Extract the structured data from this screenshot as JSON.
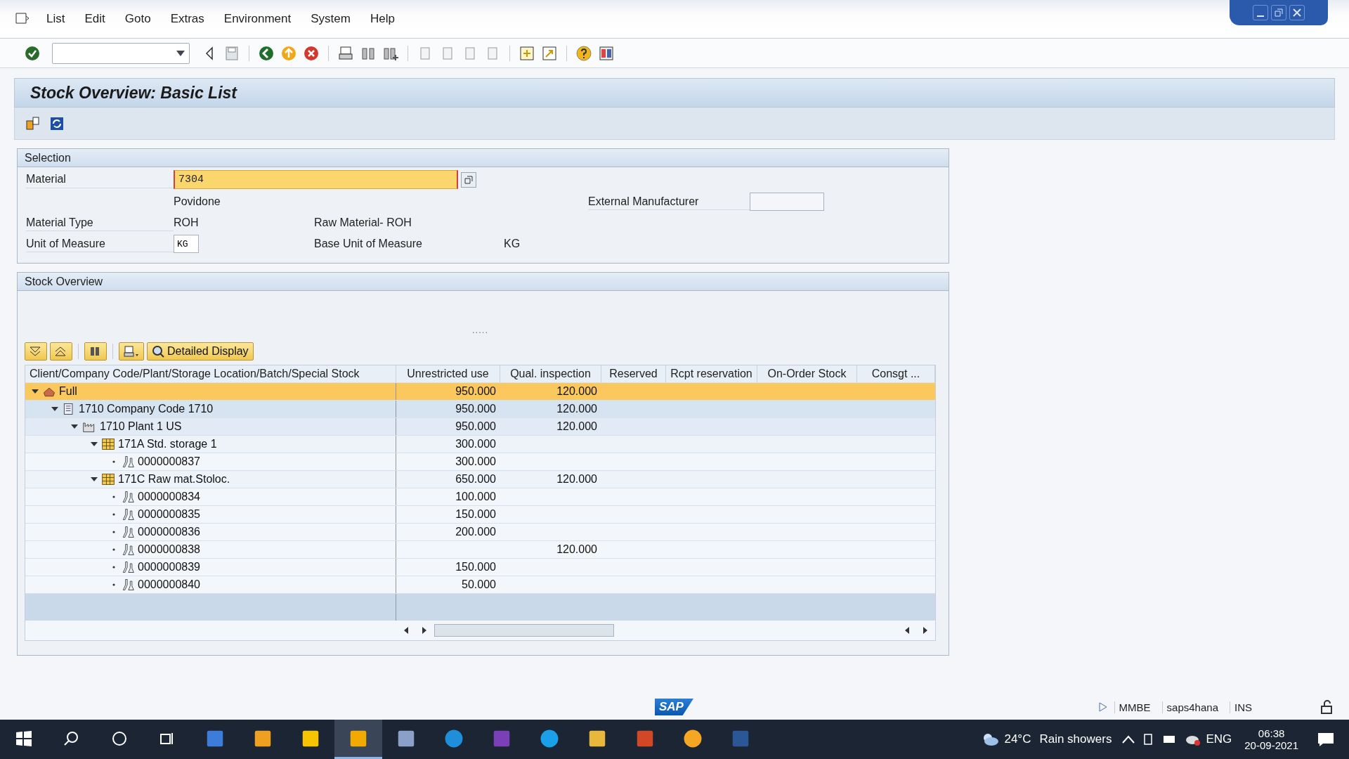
{
  "menu": [
    "List",
    "Edit",
    "Goto",
    "Extras",
    "Environment",
    "System",
    "Help"
  ],
  "title": "Stock Overview: Basic List",
  "selection": {
    "title": "Selection",
    "material": {
      "label": "Material",
      "value": "7304",
      "description": "Povidone"
    },
    "external_manufacturer": {
      "label": "External Manufacturer"
    },
    "material_type": {
      "label": "Material Type",
      "value": "ROH",
      "description": "Raw Material- ROH"
    },
    "unit": {
      "label": "Unit of Measure",
      "value": "KG",
      "base_label": "Base Unit of Measure",
      "base_value": "KG"
    }
  },
  "stock": {
    "title": "Stock Overview",
    "splitter": ".....",
    "detail_button": "Detailed Display",
    "columns": [
      "Client/Company Code/Plant/Storage Location/Batch/Special Stock",
      "Unrestricted use",
      "Qual. inspection",
      "Reserved",
      "Rcpt reservation",
      "On-Order Stock",
      "Consgt ..."
    ],
    "tree": [
      {
        "kind": "root",
        "label": "Full",
        "unrestricted": "950.000",
        "qual": "120.000",
        "selected": true,
        "expanded": true,
        "children": [
          {
            "kind": "company",
            "label": "1710 Company Code 1710",
            "unrestricted": "950.000",
            "qual": "120.000",
            "selected": false,
            "expanded": true,
            "children": [
              {
                "kind": "plant",
                "label": "1710 Plant 1 US",
                "unrestricted": "950.000",
                "qual": "120.000",
                "selected": false,
                "expanded": true,
                "children": [
                  {
                    "kind": "storage",
                    "label": "171A Std. storage 1",
                    "unrestricted": "300.000",
                    "selected": false,
                    "expanded": true,
                    "children": [
                      {
                        "kind": "batch",
                        "label": "0000000837",
                        "unrestricted": "300.000",
                        "selected": false
                      }
                    ]
                  },
                  {
                    "kind": "storage",
                    "label": "171C Raw mat.Stoloc.",
                    "unrestricted": "650.000",
                    "qual": "120.000",
                    "selected": false,
                    "expanded": true,
                    "children": [
                      {
                        "kind": "batch",
                        "label": "0000000834",
                        "unrestricted": "100.000",
                        "selected": false
                      },
                      {
                        "kind": "batch",
                        "label": "0000000835",
                        "unrestricted": "150.000",
                        "selected": false
                      },
                      {
                        "kind": "batch",
                        "label": "0000000836",
                        "unrestricted": "200.000",
                        "selected": false
                      },
                      {
                        "kind": "batch",
                        "label": "0000000838",
                        "qual": "120.000",
                        "selected": false
                      },
                      {
                        "kind": "batch",
                        "label": "0000000839",
                        "unrestricted": "150.000",
                        "selected": false
                      },
                      {
                        "kind": "batch",
                        "label": "0000000840",
                        "unrestricted": "50.000",
                        "selected": false
                      }
                    ]
                  }
                ]
              }
            ]
          }
        ]
      }
    ]
  },
  "status_bar": {
    "logo": "SAP",
    "transaction": "MMBE",
    "system": "saps4hana",
    "mode": "INS"
  },
  "taskbar": {
    "apps": [
      {
        "kind": "calculator",
        "selected": false
      },
      {
        "kind": "player",
        "selected": false
      },
      {
        "kind": "notes",
        "selected": false
      },
      {
        "kind": "sap",
        "selected": true
      },
      {
        "kind": "paint",
        "selected": false
      },
      {
        "kind": "edge",
        "selected": false
      },
      {
        "kind": "onenote",
        "selected": false
      },
      {
        "kind": "skype",
        "selected": false
      },
      {
        "kind": "folder",
        "selected": false
      },
      {
        "kind": "powerpoint",
        "selected": false
      },
      {
        "kind": "flower",
        "selected": false
      },
      {
        "kind": "word",
        "selected": false
      }
    ],
    "temperature": "24°C",
    "weather": "Rain showers",
    "language": "ENG",
    "time": "06:38",
    "date": "20-09-2021"
  }
}
